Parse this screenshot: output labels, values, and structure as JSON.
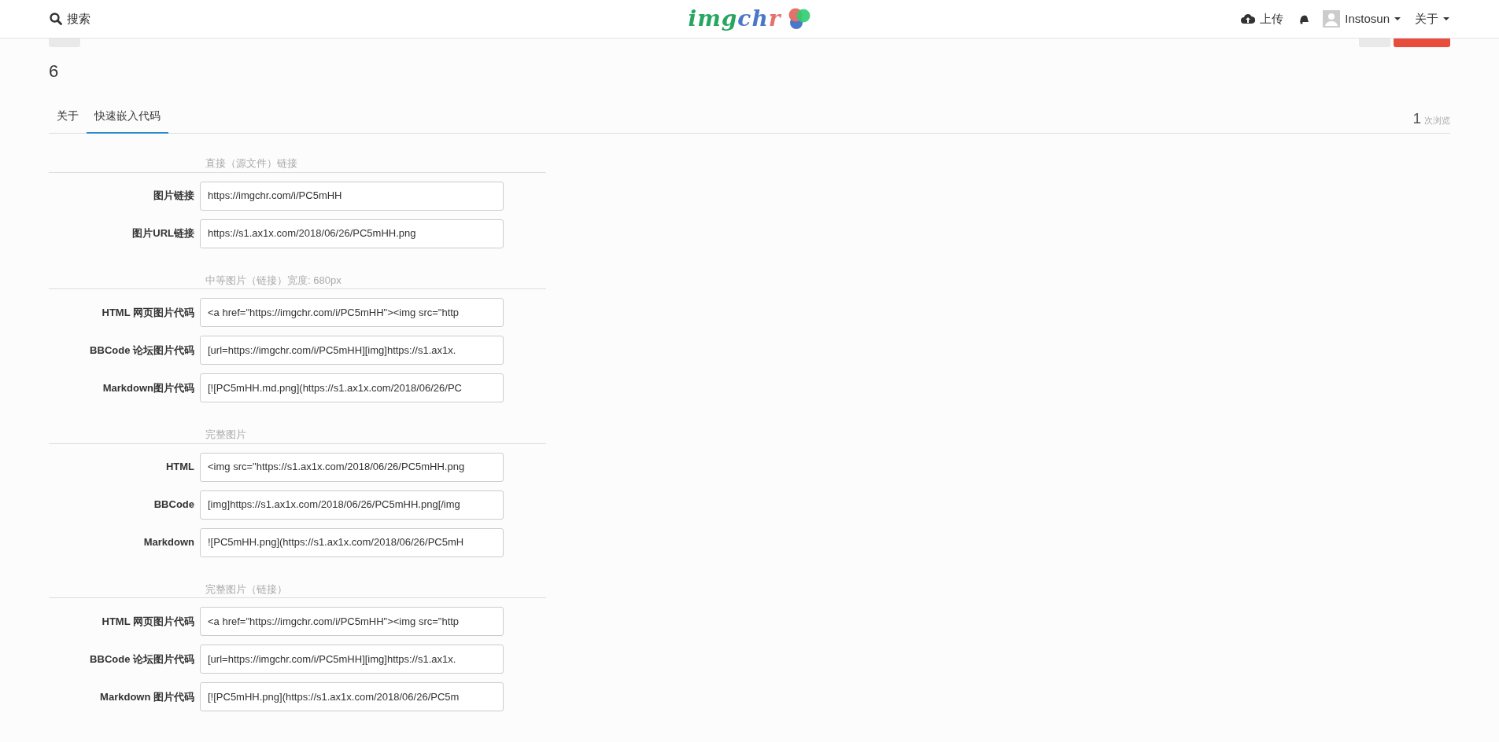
{
  "navbar": {
    "search_label": "搜索",
    "logo": [
      {
        "text": "img",
        "color": "#27a561"
      },
      {
        "text": "ch",
        "color": "#4a77c9"
      },
      {
        "text": "r",
        "color": "#e4716a"
      }
    ],
    "upload_label": "上传",
    "user_name": "Instosun",
    "about_label": "关于"
  },
  "left_buttons": [
    {
      "kind": "default"
    }
  ],
  "right_buttons": [
    {
      "kind": "default"
    },
    {
      "kind": "danger"
    }
  ],
  "title": "6",
  "tabs": [
    {
      "label": "关于",
      "selected": false
    },
    {
      "label": "快速嵌入代码",
      "selected": true
    }
  ],
  "views": {
    "count": "1",
    "label": "次浏览"
  },
  "sections": [
    {
      "heading": "直接（源文件）链接",
      "fields": [
        {
          "label": "图片链接",
          "value": "https://imgchr.com/i/PC5mHH"
        },
        {
          "label": "图片URL链接",
          "value": "https://s1.ax1x.com/2018/06/26/PC5mHH.png"
        }
      ]
    },
    {
      "heading": "中等图片（链接）宽度: 680px",
      "fields": [
        {
          "label": "HTML 网页图片代码",
          "value": "<a href=\"https://imgchr.com/i/PC5mHH\"><img src=\"http"
        },
        {
          "label": "BBCode 论坛图片代码",
          "value": "[url=https://imgchr.com/i/PC5mHH][img]https://s1.ax1x."
        },
        {
          "label": "Markdown图片代码",
          "value": "[![PC5mHH.md.png](https://s1.ax1x.com/2018/06/26/PC"
        }
      ]
    },
    {
      "heading": "完整图片",
      "fields": [
        {
          "label": "HTML",
          "value": "<img src=\"https://s1.ax1x.com/2018/06/26/PC5mHH.png"
        },
        {
          "label": "BBCode",
          "value": "[img]https://s1.ax1x.com/2018/06/26/PC5mHH.png[/img"
        },
        {
          "label": "Markdown",
          "value": "![PC5mHH.png](https://s1.ax1x.com/2018/06/26/PC5mH"
        }
      ]
    },
    {
      "heading": "完整图片（链接）",
      "fields": [
        {
          "label": "HTML 网页图片代码",
          "value": "<a href=\"https://imgchr.com/i/PC5mHH\"><img src=\"http"
        },
        {
          "label": "BBCode 论坛图片代码",
          "value": "[url=https://imgchr.com/i/PC5mHH][img]https://s1.ax1x."
        },
        {
          "label": "Markdown 图片代码",
          "value": "[![PC5mHH.png](https://s1.ax1x.com/2018/06/26/PC5m"
        }
      ]
    }
  ]
}
